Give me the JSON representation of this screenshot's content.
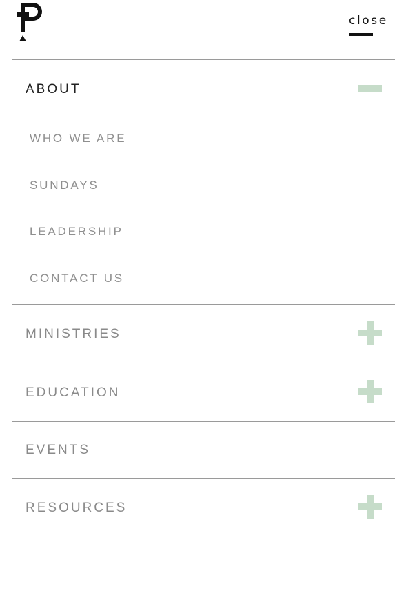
{
  "header": {
    "logo_icon": "cross-p-logo-icon",
    "close_label": "close"
  },
  "menu": {
    "items": [
      {
        "label": "ABOUT",
        "expanded": true,
        "toggle": "minus-icon",
        "subitems": [
          "WHO WE ARE",
          "SUNDAYS",
          "LEADERSHIP",
          "CONTACT US"
        ]
      },
      {
        "label": "MINISTRIES",
        "expanded": false,
        "toggle": "plus-icon"
      },
      {
        "label": "EDUCATION",
        "expanded": false,
        "toggle": "plus-icon"
      },
      {
        "label": "EVENTS",
        "expanded": false
      },
      {
        "label": "RESOURCES",
        "expanded": false,
        "toggle": "plus-icon"
      }
    ]
  },
  "colors": {
    "toggle": "#c6dcc9",
    "divider": "#9a9a9a",
    "text_active": "#222222",
    "text_muted": "#8a8a8a"
  }
}
